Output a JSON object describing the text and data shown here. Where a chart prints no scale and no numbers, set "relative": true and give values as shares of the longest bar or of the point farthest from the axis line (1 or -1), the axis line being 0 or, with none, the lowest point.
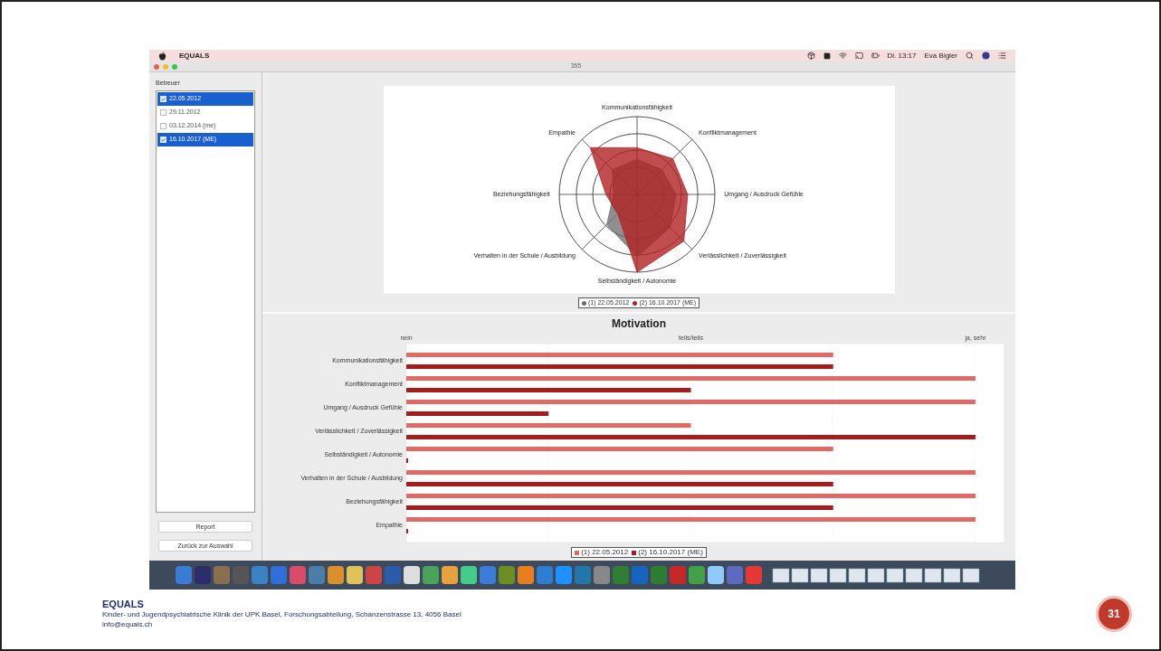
{
  "menu_bar": {
    "app_name": "EQUALS",
    "clock": "Di. 13:17",
    "user": "Eva Bigler"
  },
  "window": {
    "title": "355"
  },
  "sidebar": {
    "heading": "Betreuer",
    "items": [
      {
        "label": "22.05.2012",
        "checked": true,
        "selected": true
      },
      {
        "label": "29.11.2012",
        "checked": false,
        "selected": false
      },
      {
        "label": "03.12.2014 (me)",
        "checked": false,
        "selected": false
      },
      {
        "label": "16.10.2017 (ME)",
        "checked": true,
        "selected": true
      }
    ],
    "buttons": [
      "Report",
      "Zurück zur Auswahl"
    ]
  },
  "radar": {
    "axes": [
      "Kommunikationsfähigkeit",
      "Empathie",
      "Konfliktmanagement",
      "Beziehungsfähigkeit",
      "Umgang / Ausdruck Gefühle",
      "Verhalten in der Schule / Ausbildung",
      "Verlässlichkeit / Zuverlässigkeit",
      "Selbständigkeit / Autonomie"
    ],
    "legend": [
      {
        "label": "(1) 22.05.2012",
        "color": "#6b6b6b"
      },
      {
        "label": "(2) 16.10.2017 (ME)",
        "color": "#b22222"
      }
    ]
  },
  "bar_panel": {
    "scale_labels": [
      "nein",
      "teils/teils",
      "ja, sehr"
    ],
    "chart_data": {
      "type": "bar",
      "title": "Motivation",
      "orientation": "horizontal",
      "categories": [
        "Kommunikationsfähigkeit",
        "Konfliktmanagement",
        "Umgang / Ausdruck Gefühle",
        "Verlässlichkeit / Zuverlässigkeit",
        "Selbständigkeit / Autonomie",
        "Verhalten in der Schule / Ausbildung",
        "Beziehungsfähigkeit",
        "Empathie"
      ],
      "relative": true,
      "series": [
        {
          "name": "(1) 22.05.2012",
          "color": "#e06b66",
          "values": [
            0.75,
            1,
            1,
            0.5,
            0.75,
            1,
            1,
            1
          ]
        },
        {
          "name": "(2) 16.10.2017 (ME)",
          "color": "#a51c1c",
          "values": [
            0.75,
            0.5,
            0.25,
            1,
            0,
            0.75,
            0.75,
            0
          ]
        }
      ]
    }
  },
  "footer": {
    "org": "EQUALS",
    "address": "Kinder- und Jugendpsychiatrische Klinik der UPK Basel, Forschungsabteilung, Schanzenstrasse 13, 4056 Basel",
    "email": "info@equals.ch",
    "page_number": "31"
  }
}
